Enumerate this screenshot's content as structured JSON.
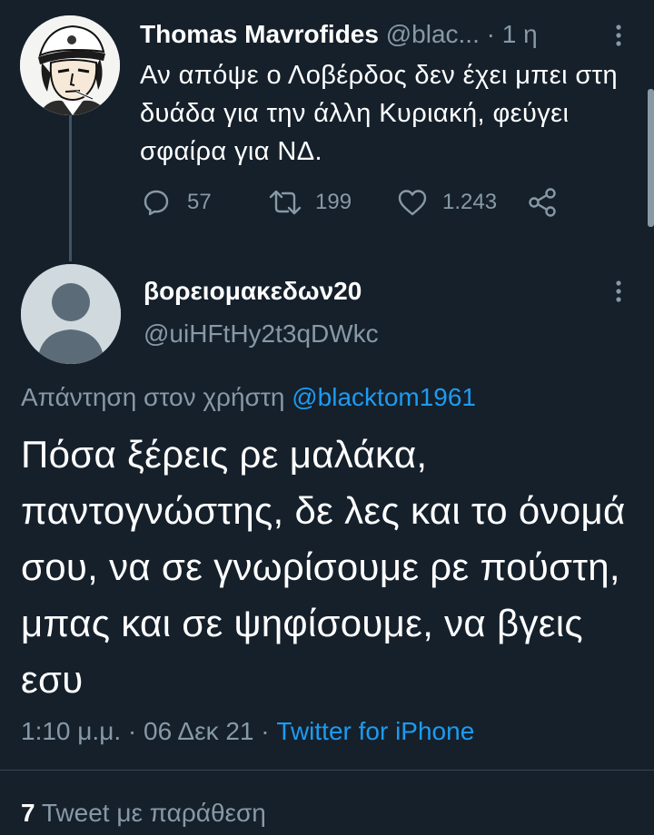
{
  "parent_tweet": {
    "author_name": "Thomas Mavrofides",
    "author_handle": "@blac...",
    "separator": "·",
    "time_ago": "1 η",
    "text": "Αν απόψε ο Λοβέρδος δεν έχει μπει στη δυάδα για την άλλη Κυριακή, φεύγει σφαίρα για ΝΔ.",
    "replies": "57",
    "retweets": "199",
    "likes": "1.243",
    "more_icon": "more-vertical-icon",
    "icons": [
      "reply-icon",
      "retweet-icon",
      "like-icon",
      "share-icon"
    ]
  },
  "main_tweet": {
    "author_name": "βορειομακεδων20",
    "author_handle": "@uiHFtHy2t3qDWkc",
    "reply_prefix": "Απάντηση στον χρήστη",
    "reply_to": "@blacktom1961",
    "text": "Πόσα ξέρεις ρε μαλάκα, παντογνώστης, δε λες και το όνομά σου, να σε γνωρίσουμε ρε πούστη, μπας και σε ψηφίσουμε, να βγεις εσυ",
    "time": "1:10 μ.μ.",
    "dot1": "·",
    "date": "06 Δεκ 21",
    "dot2": "·",
    "source": "Twitter for iPhone",
    "quote_count": "7",
    "quote_label": "Tweet με παράθεση",
    "more_icon": "more-vertical-icon"
  },
  "colors": {
    "background": "#15202b",
    "secondary_text": "#8899a6",
    "link": "#1d9bf0",
    "divider": "#38444d",
    "thread_line": "#3d5466"
  }
}
